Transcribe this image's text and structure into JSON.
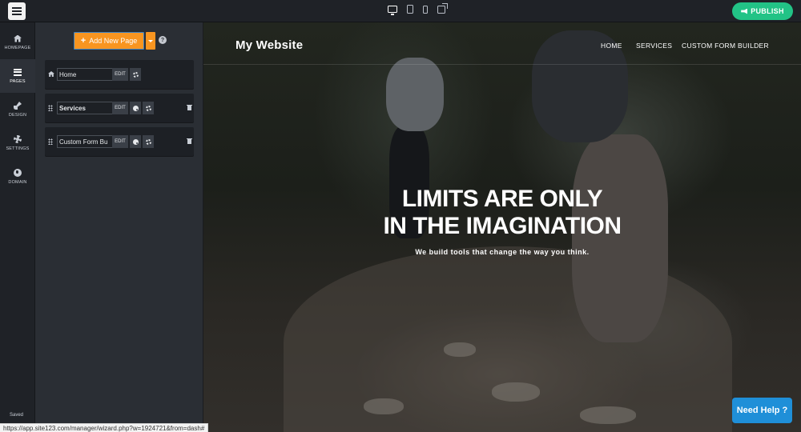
{
  "topbar": {
    "publish_label": "PUBLISH"
  },
  "leftnav": {
    "items": [
      {
        "label": "HOMEPAGE"
      },
      {
        "label": "PAGES"
      },
      {
        "label": "DESIGN"
      },
      {
        "label": "SETTINGS"
      },
      {
        "label": "DOMAIN"
      }
    ],
    "saved_label": "Saved"
  },
  "pages_panel": {
    "add_label": "Add New Page",
    "help": "?",
    "rows": [
      {
        "name": "Home",
        "edit": "EDIT"
      },
      {
        "name": "Services",
        "edit": "EDIT"
      },
      {
        "name": "Custom Form Bu",
        "edit": "EDIT"
      }
    ]
  },
  "preview": {
    "brand": "My Website",
    "nav": [
      "HOME",
      "SERVICES",
      "CUSTOM FORM BUILDER"
    ],
    "hero_line1": "LIMITS ARE ONLY",
    "hero_line2": "IN THE IMAGINATION",
    "hero_sub": "We build tools that change the way you think."
  },
  "help_button": "Need Help ?",
  "status_url": "https://app.site123.com/manager/wizard.php?w=1924721&from=dash#",
  "colors": {
    "publish": "#22c386",
    "add_page": "#f89520",
    "help_button": "#1f8fd8"
  }
}
